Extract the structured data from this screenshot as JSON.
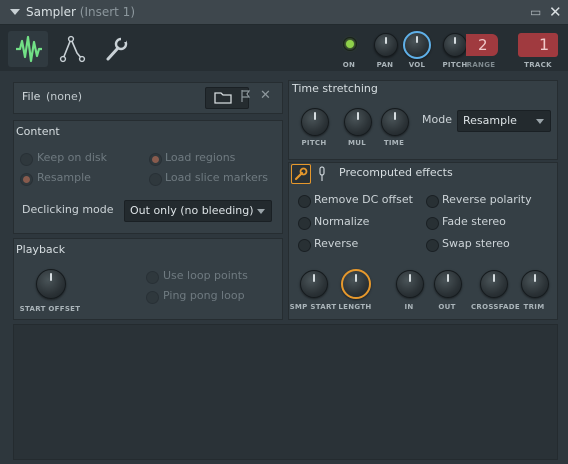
{
  "window": {
    "title": "Sampler",
    "subtitle": "(Insert 1)"
  },
  "toolbar": {
    "tabs": [
      {
        "icon": "waveform-icon",
        "active": true
      },
      {
        "icon": "envelope-icon",
        "active": false
      },
      {
        "icon": "wrench-icon",
        "active": false
      }
    ],
    "on_label": "ON",
    "pan_label": "PAN",
    "vol_label": "VOL",
    "pitch_label": "PITCH",
    "range_label": "RANGE",
    "range_value": "2",
    "track_label": "TRACK",
    "track_value": "1",
    "led_color": "#8fd14a"
  },
  "file": {
    "label": "File",
    "value": "(none)"
  },
  "content": {
    "title": "Content",
    "options": [
      {
        "label": "Keep on disk",
        "on": false,
        "dim": true
      },
      {
        "label": "Load regions",
        "on": true,
        "dim": true
      },
      {
        "label": "Resample",
        "on": true,
        "dim": true
      },
      {
        "label": "Load slice markers",
        "on": false,
        "dim": true
      }
    ],
    "declicking_label": "Declicking mode",
    "declicking_value": "Out only (no bleeding)"
  },
  "playback": {
    "title": "Playback",
    "start_offset_label": "START OFFSET",
    "options": [
      {
        "label": "Use loop points",
        "on": false,
        "dim": true
      },
      {
        "label": "Ping pong loop",
        "on": false,
        "dim": true
      }
    ]
  },
  "time_stretching": {
    "title": "Time stretching",
    "knobs": [
      "PITCH",
      "MUL",
      "TIME"
    ],
    "mode_label": "Mode",
    "mode_value": "Resample"
  },
  "precomputed": {
    "title": "Precomputed effects",
    "options": [
      {
        "label": "Remove DC offset",
        "on": false
      },
      {
        "label": "Reverse polarity",
        "on": false
      },
      {
        "label": "Normalize",
        "on": false
      },
      {
        "label": "Fade stereo",
        "on": false
      },
      {
        "label": "Reverse",
        "on": false
      },
      {
        "label": "Swap stereo",
        "on": false
      }
    ],
    "knobs": [
      "SMP START",
      "LENGTH",
      "IN",
      "OUT",
      "CROSSFADE",
      "TRIM"
    ]
  },
  "colors": {
    "accent_orange": "#e6982c",
    "accent_blue": "#5fb0e8",
    "radio_on": "#ee7d57",
    "range_red": "#a03a3f"
  }
}
